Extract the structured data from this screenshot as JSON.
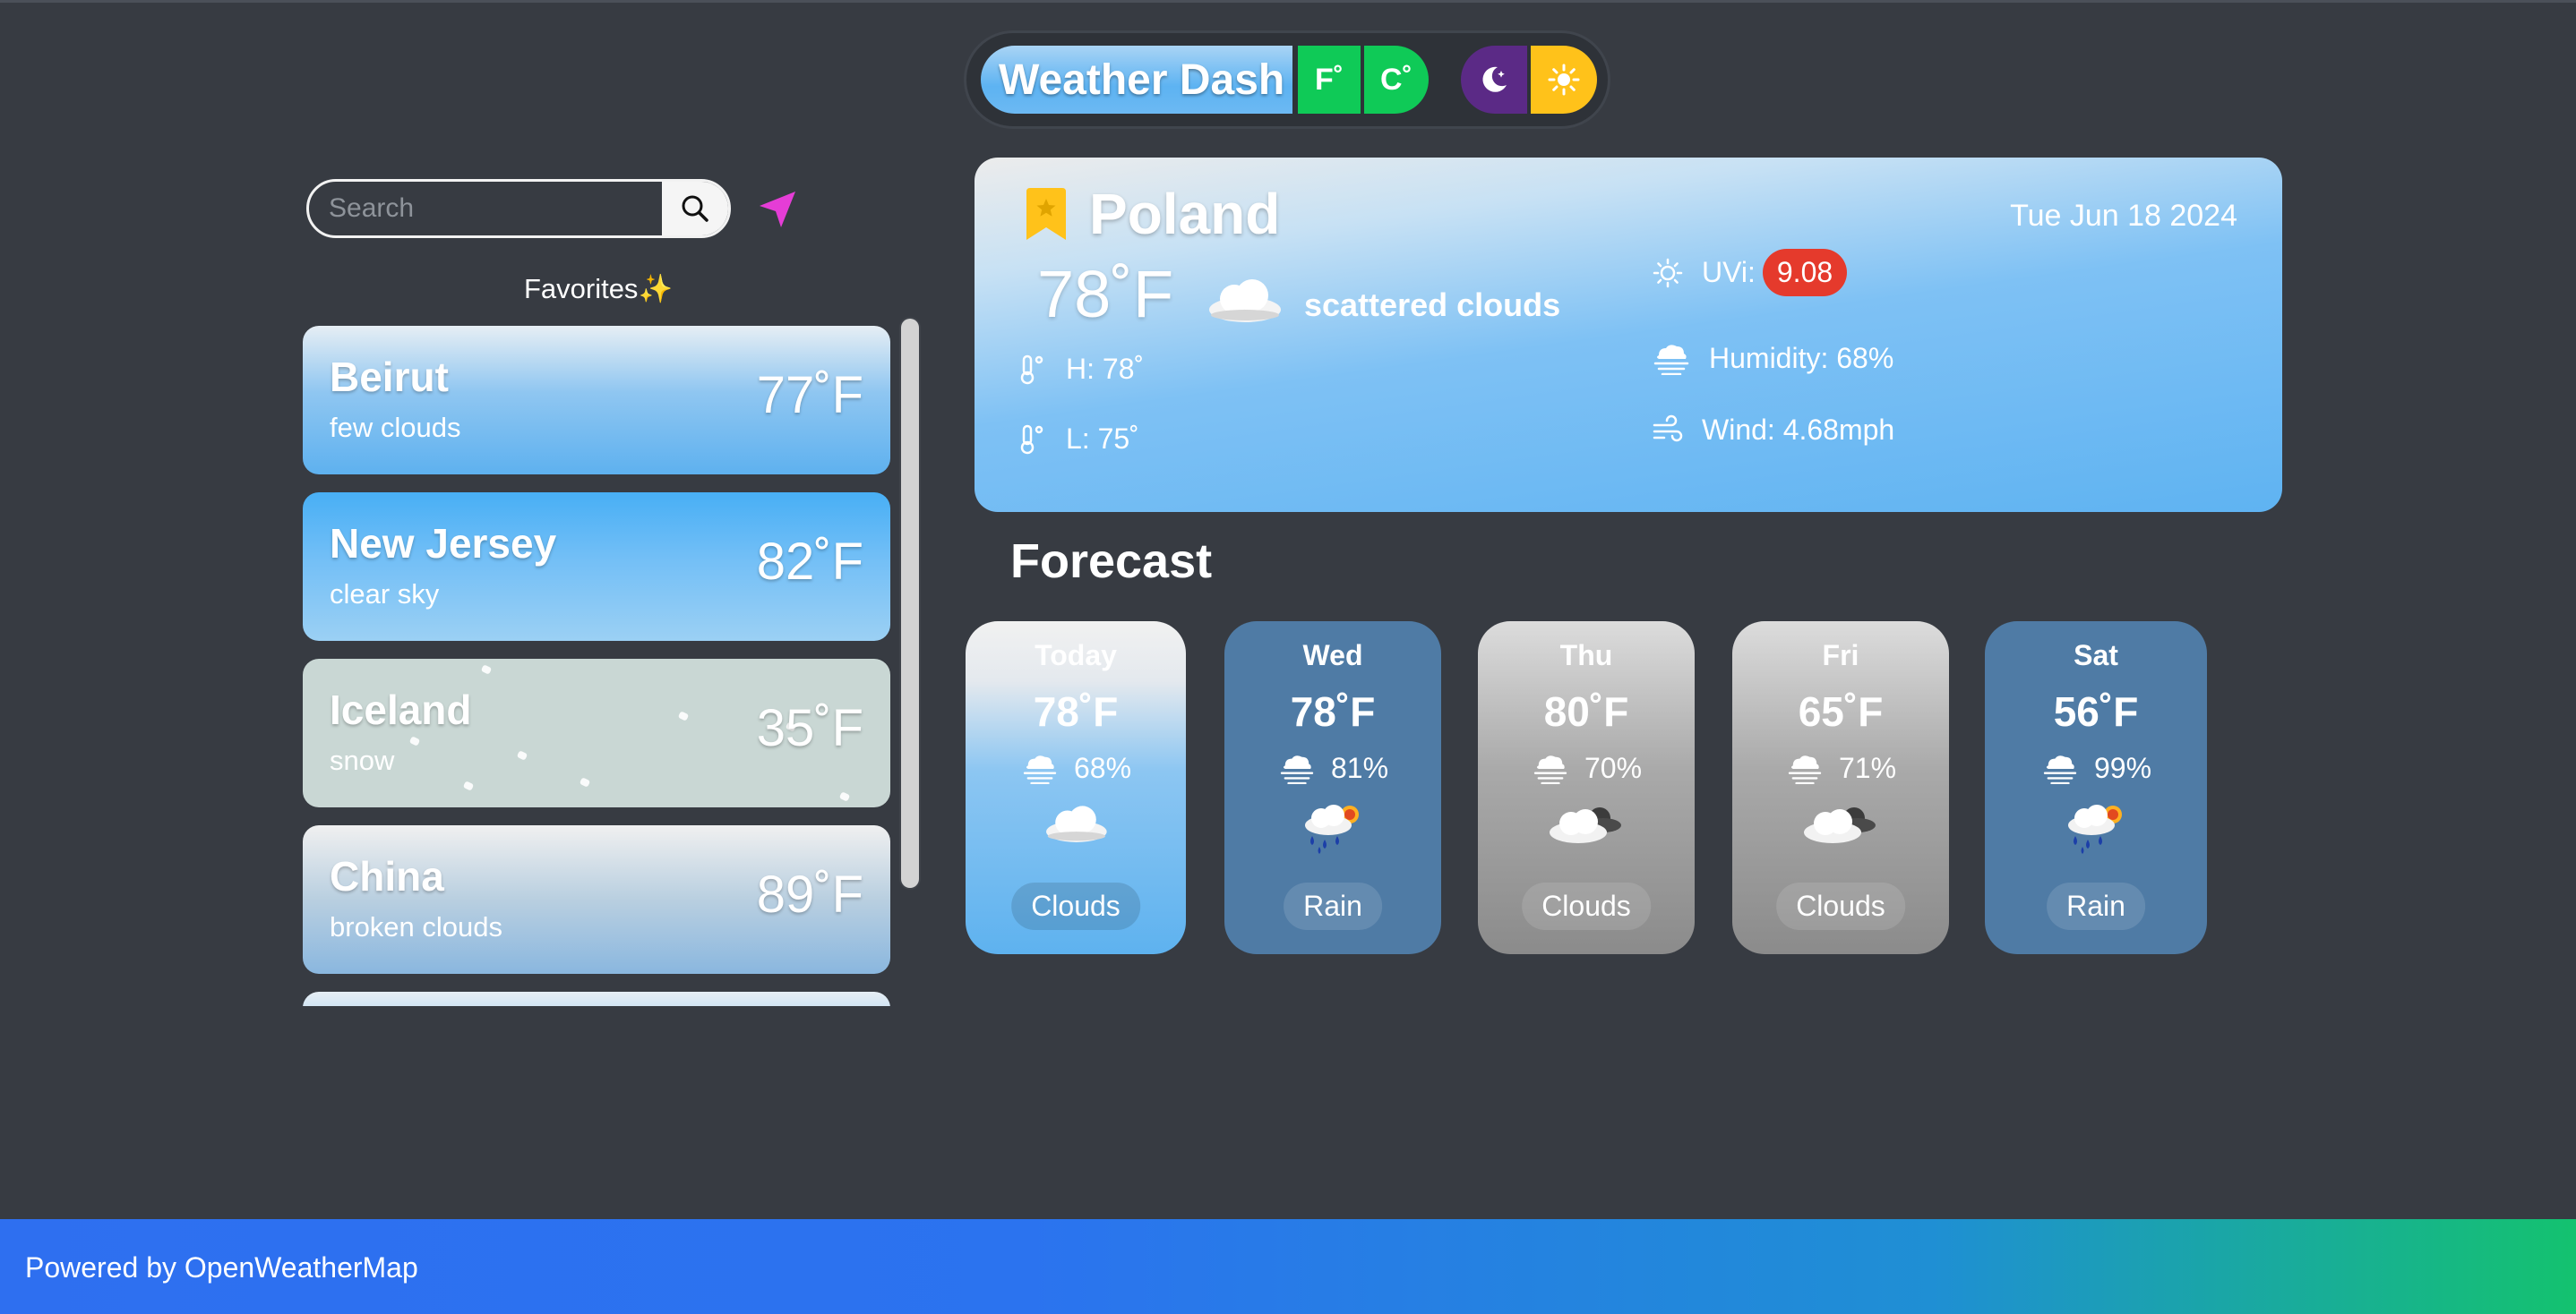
{
  "header": {
    "title": "Weather Dash",
    "unit_f": "F˚",
    "unit_c": "C˚",
    "theme_dark_icon": "moon-icon",
    "theme_light_icon": "sun-icon",
    "unit_button_color": "#0fca57",
    "dark_button_color": "#5b2a86",
    "light_button_color": "#ffc21a"
  },
  "search": {
    "placeholder": "Search",
    "icon": "magnifier-icon",
    "locate_icon": "location-arrow-icon",
    "locate_color": "#e53dd6"
  },
  "favorites": {
    "title": "Favorites",
    "title_emoji": "✨",
    "items": [
      {
        "city": "Beirut",
        "desc": "few clouds",
        "temp": "77˚F"
      },
      {
        "city": "New Jersey",
        "desc": "clear sky",
        "temp": "82˚F"
      },
      {
        "city": "Iceland",
        "desc": "snow",
        "temp": "35˚F"
      },
      {
        "city": "China",
        "desc": "broken clouds",
        "temp": "89˚F"
      }
    ]
  },
  "current": {
    "country": "Poland",
    "date": "Tue Jun 18 2024",
    "temp": "78˚F",
    "desc": "scattered clouds",
    "high": "H: 78˚",
    "low": "L: 75˚",
    "uvi_label": "UVi:",
    "uvi_value": "9.08",
    "humidity": "Humidity: 68%",
    "wind": "Wind: 4.68mph",
    "bookmark_color": "#ffc21a",
    "uvi_color": "#e53a2c"
  },
  "forecast": {
    "title": "Forecast",
    "days": [
      {
        "day": "Today",
        "temp": "78˚F",
        "humidity": "68%",
        "condition": "Clouds",
        "icon": "cloud-icon"
      },
      {
        "day": "Wed",
        "temp": "78˚F",
        "humidity": "81%",
        "condition": "Rain",
        "icon": "rain-sun-icon"
      },
      {
        "day": "Thu",
        "temp": "80˚F",
        "humidity": "70%",
        "condition": "Clouds",
        "icon": "broken-clouds-icon"
      },
      {
        "day": "Fri",
        "temp": "65˚F",
        "humidity": "71%",
        "condition": "Clouds",
        "icon": "broken-clouds-icon"
      },
      {
        "day": "Sat",
        "temp": "56˚F",
        "humidity": "99%",
        "condition": "Rain",
        "icon": "rain-sun-icon"
      }
    ]
  },
  "footer": {
    "text": "Powered by OpenWeatherMap"
  }
}
